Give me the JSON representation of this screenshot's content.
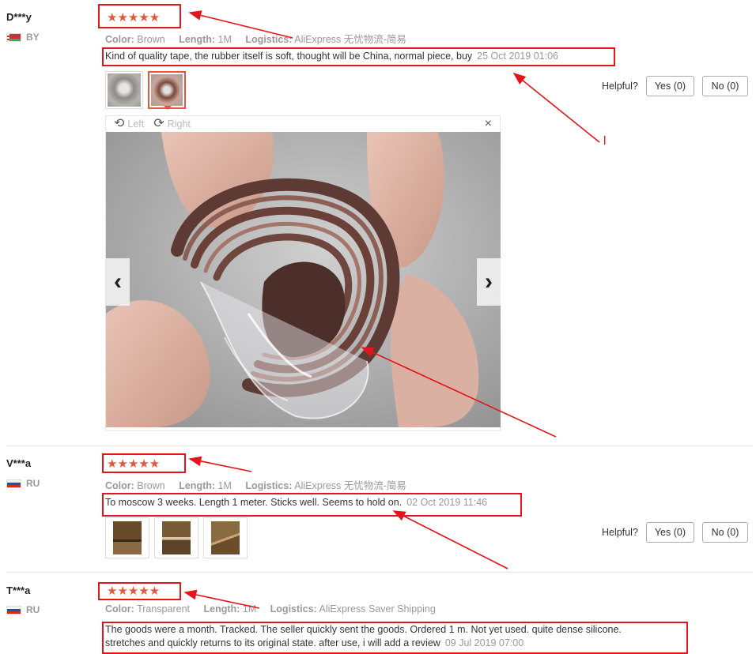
{
  "reviews": [
    {
      "user": "D***y",
      "country": "BY",
      "stars": "★★★★★",
      "attr_labels": {
        "color": "Color:",
        "length": "Length:",
        "logistics": "Logistics:"
      },
      "color": "Brown",
      "length": "1M",
      "logistics": "AliExpress 无忧物流-简易",
      "text": "Kind of quality tape, the rubber itself is soft, thought will be China, normal piece, buy",
      "date": "25 Oct 2019 01:06",
      "helpful_label": "Helpful?",
      "yes": "Yes (0)",
      "no": "No (0)"
    },
    {
      "user": "V***a",
      "country": "RU",
      "stars": "★★★★★",
      "attr_labels": {
        "color": "Color:",
        "length": "Length:",
        "logistics": "Logistics:"
      },
      "color": "Brown",
      "length": "1M",
      "logistics": "AliExpress 无忧物流-简易",
      "text": "To moscow 3 weeks. Length 1 meter. Sticks well. Seems to hold on.",
      "date": "02 Oct 2019 11:46",
      "helpful_label": "Helpful?",
      "yes": "Yes (0)",
      "no": "No (0)"
    },
    {
      "user": "T***a",
      "country": "RU",
      "stars": "★★★★★",
      "attr_labels": {
        "color": "Color:",
        "length": "Length:",
        "logistics": "Logistics:"
      },
      "color": "Transparent",
      "length": "1M",
      "logistics": "AliExpress Saver Shipping",
      "text_line1": "The goods were a month. Tracked. The seller quickly sent the goods. Ordered 1 m. Not yet used. quite dense silicone.",
      "text_line2": "stretches and quickly returns to its original state. after use, i will add a review",
      "date": "09 Jul 2019 07:00"
    }
  ],
  "viewer": {
    "left_label": "Left",
    "right_label": "Right",
    "close": "×",
    "prev": "‹",
    "next": "›"
  },
  "annotation_marker": "l",
  "colors": {
    "star": "#e8553a",
    "annotation": "#e3151a",
    "muted_text": "#999999"
  },
  "icons": {
    "rotate_left": "rotate-left-icon",
    "rotate_right": "rotate-right-icon",
    "close": "close-icon",
    "prev": "chevron-left-icon",
    "next": "chevron-right-icon"
  }
}
